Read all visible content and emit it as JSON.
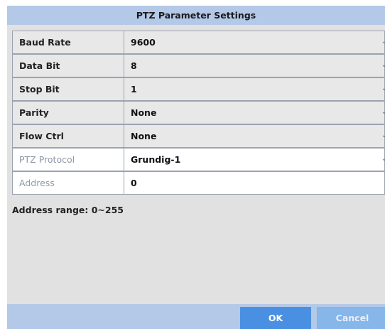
{
  "dialog": {
    "title": "PTZ Parameter Settings",
    "fields": [
      {
        "label": "Baud Rate",
        "value": "9600",
        "type": "dropdown"
      },
      {
        "label": "Data Bit",
        "value": "8",
        "type": "dropdown"
      },
      {
        "label": "Stop Bit",
        "value": "1",
        "type": "dropdown"
      },
      {
        "label": "Parity",
        "value": "None",
        "type": "dropdown"
      },
      {
        "label": "Flow Ctrl",
        "value": "None",
        "type": "dropdown"
      },
      {
        "label": "PTZ Protocol",
        "value": "Grundig-1",
        "type": "dropdown"
      },
      {
        "label": "Address",
        "value": "0",
        "type": "text"
      }
    ],
    "hint": "Address range: 0~255",
    "ok_label": "OK",
    "cancel_label": "Cancel"
  },
  "icons": {
    "dropdown": "chevron-down-icon"
  }
}
